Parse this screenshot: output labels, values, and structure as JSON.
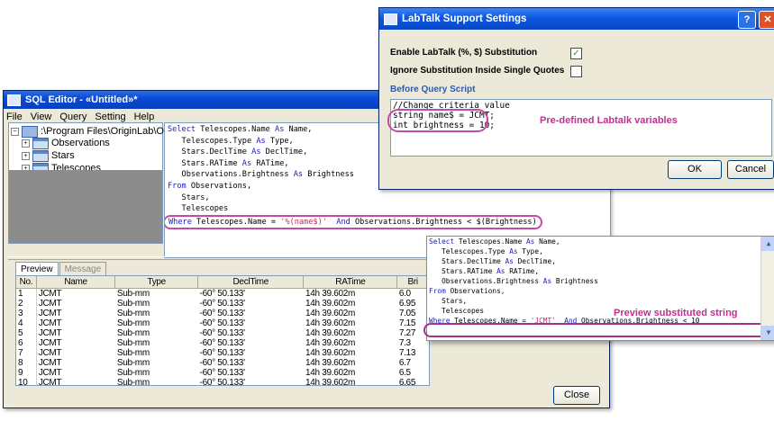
{
  "sql_editor": {
    "title": "SQL Editor - «Untitled»*",
    "menu": [
      "File",
      "View",
      "Query",
      "Setting",
      "Help"
    ],
    "toolbar_icons": [
      "open-icon",
      "save-icon",
      "connect-icon",
      "disconnect-icon",
      "build-query-icon",
      "settings-icon"
    ],
    "tree": {
      "root": ":\\Program Files\\OriginLab\\O",
      "tables": [
        "Observations",
        "Stars",
        "Telescopes"
      ]
    },
    "sql_lines": [
      {
        "kw": "Select",
        "rest": " Telescopes.Name ",
        "kw2": "As",
        "rest2": " Name,"
      },
      {
        "kw": "",
        "rest": "   Telescopes.Type ",
        "kw2": "As",
        "rest2": " Type,"
      },
      {
        "kw": "",
        "rest": "   Stars.DeclTime ",
        "kw2": "As",
        "rest2": " DeclTime,"
      },
      {
        "kw": "",
        "rest": "   Stars.RATime ",
        "kw2": "As",
        "rest2": " RATime,"
      },
      {
        "kw": "",
        "rest": "   Observations.Brightness ",
        "kw2": "As",
        "rest2": " Brightness"
      },
      {
        "kw": "From",
        "rest": " Observations,",
        "kw2": "",
        "rest2": ""
      },
      {
        "kw": "",
        "rest": "   Stars,",
        "kw2": "",
        "rest2": ""
      },
      {
        "kw": "",
        "rest": "   Telescopes",
        "kw2": "",
        "rest2": ""
      }
    ],
    "sql_where": {
      "kw": "Where",
      "a": " Telescopes.Name = ",
      "str": "'%(name$)'",
      "and": "And",
      "b": " Observations.Brightness < $(Brightness)"
    },
    "tabs": [
      "Preview",
      "Message"
    ],
    "columns": [
      "No.",
      "Name",
      "Type",
      "DeclTime",
      "RATime",
      "Bri"
    ],
    "rows": [
      [
        "1",
        "JCMT",
        "Sub-mm",
        "-60° 50.133'",
        "14h 39.602m",
        "6.0"
      ],
      [
        "2",
        "JCMT",
        "Sub-mm",
        "-60° 50.133'",
        "14h 39.602m",
        "6.95"
      ],
      [
        "3",
        "JCMT",
        "Sub-mm",
        "-60° 50.133'",
        "14h 39.602m",
        "7.05"
      ],
      [
        "4",
        "JCMT",
        "Sub-mm",
        "-60° 50.133'",
        "14h 39.602m",
        "7.15"
      ],
      [
        "5",
        "JCMT",
        "Sub-mm",
        "-60° 50.133'",
        "14h 39.602m",
        "7.27"
      ],
      [
        "6",
        "JCMT",
        "Sub-mm",
        "-60° 50.133'",
        "14h 39.602m",
        "7.3"
      ],
      [
        "7",
        "JCMT",
        "Sub-mm",
        "-60° 50.133'",
        "14h 39.602m",
        "7.13"
      ],
      [
        "8",
        "JCMT",
        "Sub-mm",
        "-60° 50.133'",
        "14h 39.602m",
        "6.7"
      ],
      [
        "9",
        "JCMT",
        "Sub-mm",
        "-60° 50.133'",
        "14h 39.602m",
        "6.5"
      ],
      [
        "10",
        "JCMT",
        "Sub-mm",
        "-60° 50.133'",
        "14h 39.602m",
        "6.65"
      ]
    ],
    "close_label": "Close"
  },
  "preview_popup": {
    "lines": [
      {
        "kw": "Select",
        "rest": " Telescopes.Name ",
        "kw2": "As",
        "rest2": " Name,"
      },
      {
        "kw": "",
        "rest": "   Telescopes.Type ",
        "kw2": "As",
        "rest2": " Type,"
      },
      {
        "kw": "",
        "rest": "   Stars.DeclTime ",
        "kw2": "As",
        "rest2": " DeclTime,"
      },
      {
        "kw": "",
        "rest": "   Stars.RATime ",
        "kw2": "As",
        "rest2": " RATime,"
      },
      {
        "kw": "",
        "rest": "   Observations.Brightness ",
        "kw2": "As",
        "rest2": " Brightness"
      },
      {
        "kw": "From",
        "rest": " Observations,",
        "kw2": "",
        "rest2": ""
      },
      {
        "kw": "",
        "rest": "   Stars,",
        "kw2": "",
        "rest2": ""
      },
      {
        "kw": "",
        "rest": "   Telescopes",
        "kw2": "",
        "rest2": ""
      }
    ],
    "where": {
      "kw": "Where",
      "a": " Telescopes.Name = ",
      "str": "'JCMT'",
      "and": "And",
      "b": " Observations.Brightness < 10"
    },
    "note": "Preview substituted string"
  },
  "labtalk": {
    "title": "LabTalk Support Settings",
    "enable_label": "Enable LabTalk (%, $) Substitution",
    "enable_checked": "✓",
    "ignore_label": "Ignore Substitution Inside Single Quotes",
    "before_query": "Before Query Script",
    "script_lines": [
      "//Change criteria value",
      "string name$ = JCMT;",
      "int brightness = 10;"
    ],
    "note": "Pre-defined Labtalk variables",
    "ok_label": "OK",
    "cancel_label": "Cancel"
  },
  "colors": {
    "keyword": "#2020c0",
    "annotation": "#c03090",
    "titlebar": "#0a4ad8"
  }
}
